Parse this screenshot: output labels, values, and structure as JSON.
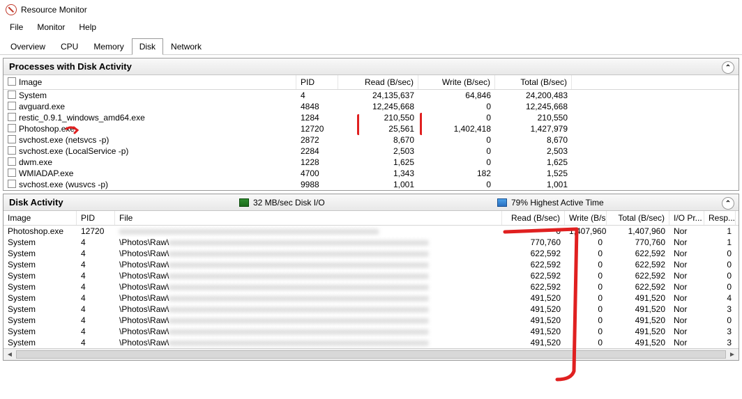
{
  "window": {
    "title": "Resource Monitor"
  },
  "menu": {
    "file": "File",
    "monitor": "Monitor",
    "help": "Help"
  },
  "tabs": {
    "overview": "Overview",
    "cpu": "CPU",
    "memory": "Memory",
    "disk": "Disk",
    "network": "Network"
  },
  "panel1": {
    "title": "Processes with Disk Activity",
    "headers": {
      "image": "Image",
      "pid": "PID",
      "read": "Read (B/sec)",
      "write": "Write (B/sec)",
      "total": "Total (B/sec)"
    },
    "rows": [
      {
        "image": "System",
        "pid": "4",
        "read": "24,135,637",
        "write": "64,846",
        "total": "24,200,483"
      },
      {
        "image": "avguard.exe",
        "pid": "4848",
        "read": "12,245,668",
        "write": "0",
        "total": "12,245,668"
      },
      {
        "image": "restic_0.9.1_windows_amd64.exe",
        "pid": "1284",
        "read": "210,550",
        "write": "0",
        "total": "210,550"
      },
      {
        "image": "Photoshop.exe",
        "pid": "12720",
        "read": "25,561",
        "write": "1,402,418",
        "total": "1,427,979"
      },
      {
        "image": "svchost.exe (netsvcs -p)",
        "pid": "2872",
        "read": "8,670",
        "write": "0",
        "total": "8,670"
      },
      {
        "image": "svchost.exe (LocalService -p)",
        "pid": "2284",
        "read": "2,503",
        "write": "0",
        "total": "2,503"
      },
      {
        "image": "dwm.exe",
        "pid": "1228",
        "read": "1,625",
        "write": "0",
        "total": "1,625"
      },
      {
        "image": "WMIADAP.exe",
        "pid": "4700",
        "read": "1,343",
        "write": "182",
        "total": "1,525"
      },
      {
        "image": "svchost.exe (wusvcs -p)",
        "pid": "9988",
        "read": "1,001",
        "write": "0",
        "total": "1,001"
      }
    ]
  },
  "panel2": {
    "title": "Disk Activity",
    "stat1": "32 MB/sec Disk I/O",
    "stat2": "79% Highest Active Time",
    "headers": {
      "image": "Image",
      "pid": "PID",
      "file": "File",
      "read": "Read (B/sec)",
      "write": "Write (B/s",
      "total": "Total (B/sec)",
      "iopr": "I/O Pr...",
      "resp": "Resp..."
    },
    "rows": [
      {
        "image": "Photoshop.exe",
        "pid": "12720",
        "file": "",
        "read": "0",
        "write": "1,407,960",
        "total": "1,407,960",
        "iopr": "Nor",
        "resp": "1"
      },
      {
        "image": "System",
        "pid": "4",
        "file": "\\Photos\\Raw\\",
        "read": "770,760",
        "write": "0",
        "total": "770,760",
        "iopr": "Nor",
        "resp": "1"
      },
      {
        "image": "System",
        "pid": "4",
        "file": "\\Photos\\Raw\\",
        "read": "622,592",
        "write": "0",
        "total": "622,592",
        "iopr": "Nor",
        "resp": "0"
      },
      {
        "image": "System",
        "pid": "4",
        "file": "\\Photos\\Raw\\",
        "read": "622,592",
        "write": "0",
        "total": "622,592",
        "iopr": "Nor",
        "resp": "0"
      },
      {
        "image": "System",
        "pid": "4",
        "file": "\\Photos\\Raw\\",
        "read": "622,592",
        "write": "0",
        "total": "622,592",
        "iopr": "Nor",
        "resp": "0"
      },
      {
        "image": "System",
        "pid": "4",
        "file": "\\Photos\\Raw\\",
        "read": "622,592",
        "write": "0",
        "total": "622,592",
        "iopr": "Nor",
        "resp": "0"
      },
      {
        "image": "System",
        "pid": "4",
        "file": "\\Photos\\Raw\\",
        "read": "491,520",
        "write": "0",
        "total": "491,520",
        "iopr": "Nor",
        "resp": "4"
      },
      {
        "image": "System",
        "pid": "4",
        "file": "\\Photos\\Raw\\",
        "read": "491,520",
        "write": "0",
        "total": "491,520",
        "iopr": "Nor",
        "resp": "3"
      },
      {
        "image": "System",
        "pid": "4",
        "file": "\\Photos\\Raw\\",
        "read": "491,520",
        "write": "0",
        "total": "491,520",
        "iopr": "Nor",
        "resp": "0"
      },
      {
        "image": "System",
        "pid": "4",
        "file": "\\Photos\\Raw\\",
        "read": "491,520",
        "write": "0",
        "total": "491,520",
        "iopr": "Nor",
        "resp": "3"
      },
      {
        "image": "System",
        "pid": "4",
        "file": "\\Photos\\Raw\\",
        "read": "491,520",
        "write": "0",
        "total": "491,520",
        "iopr": "Nor",
        "resp": "3"
      }
    ]
  }
}
